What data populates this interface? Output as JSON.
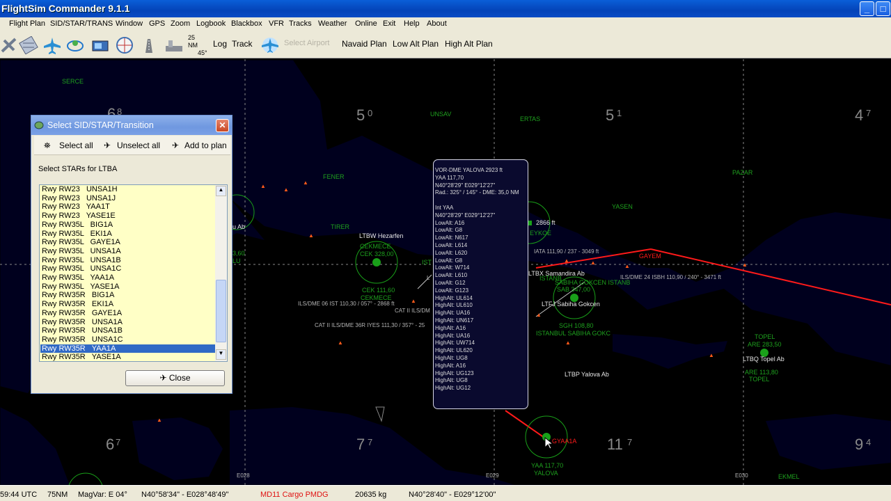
{
  "window": {
    "title": "FlightSim Commander 9.1.1"
  },
  "menu": [
    "Flight Plan",
    "SID/STAR/TRANS",
    "Window",
    "GPS",
    "Zoom",
    "Logbook",
    "Blackbox",
    "VFR",
    "Tracks",
    "Weather",
    "Online",
    "Exit",
    "Help",
    "About"
  ],
  "toolbar": {
    "zoom_top": "25",
    "zoom_mid": "NM",
    "zoom_bot": "45°",
    "log": "Log",
    "track": "Track",
    "select_airport": "Select Airport",
    "navaid_plan": "Navaid Plan",
    "low_alt_plan": "Low Alt Plan",
    "high_alt_plan": "High Alt Plan"
  },
  "map": {
    "grid_numbers": [
      {
        "big": "6",
        "small": "8"
      },
      {
        "big": "5",
        "small": "0"
      },
      {
        "big": "5",
        "small": "1"
      },
      {
        "big": "4",
        "small": "7"
      },
      {
        "big": "6",
        "small": "7"
      },
      {
        "big": "7",
        "small": "7"
      },
      {
        "big": "11",
        "small": "7"
      },
      {
        "big": "9",
        "small": "4"
      }
    ],
    "waypoints": [
      "SERCE",
      "UNSAV",
      "ERTAS",
      "FENER",
      "PAZAR",
      "YASEN",
      "TIRER",
      "GAYEM",
      "TOPEL",
      "EKMEL"
    ],
    "labels": [
      "LTBW Hezarfen",
      "LTFJ Sabiha Gokcen",
      "LTBX Samandira Ab",
      "LTBQ Topel Ab",
      "LTBP Yalova Ab",
      "SABIHA GOKCEN ISTANB",
      "SAB 347,00",
      "ISTANBUL SABIHA GOKC",
      "SGH 108,80",
      "CEKMECE",
      "CEK 328,00",
      "CEK 111,60",
      "CEKMECE",
      "ILS/DME 06  IST 110,30 / 057° - 2868 ft",
      "CAT II ILS/DME 36R  IYES 111,30 / 357° - 25",
      "CAT II ILS/DM",
      "IATA 111,90 / 237 - 3049 ft",
      "ILS/DME 24  ISBH 110,90 / 240° - 3471 ft",
      "ARE 283,50",
      "ARE 113,80",
      "TOPEL",
      "YAA 117,70",
      "YALOVA",
      "2866 ft",
      "EYKOE",
      "E028",
      "E029",
      "E030",
      "u Ab",
      "3,60",
      "LU",
      "IST",
      "L",
      "ISTANB",
      "GYAA1A"
    ],
    "route_color": "#ff1a1a"
  },
  "popup": {
    "lines": [
      "VOR-DME YALOVA 2923 ft",
      "YAA 117,70",
      "N40°28'29\"  E029°12'27\"",
      "Rad.: 325° / 145° - DME: 35,0 NM",
      "",
      "Int YAA",
      "N40°28'29\"  E029°12'27\"",
      "LowAlt: A16",
      "LowAlt: G8",
      "LowAlt: N617",
      "LowAlt: L614",
      "LowAlt: L620",
      "LowAlt: G8",
      "LowAlt: W714",
      "LowAlt: L610",
      "LowAlt: G12",
      "LowAlt: G123",
      "HighAlt: UL614",
      "HighAlt: UL610",
      "HighAlt: UA16",
      "HighAlt: UN617",
      "HighAlt: A16",
      "HighAlt: UA16",
      "HighAlt: UW714",
      "HighAlt: UL620",
      "HighAlt: UG8",
      "HighAlt: A16",
      "HighAlt: UG123",
      "HighAlt: UG8",
      "HighAlt: UG12"
    ]
  },
  "dialog": {
    "title": "Select SID/STAR/Transition",
    "select_all": "Select all",
    "unselect_all": "Unselect all",
    "add_to_plan": "Add to plan",
    "label": "Select STARs for LTBA",
    "items": [
      "Rwy RW23   UNSA1H",
      "Rwy RW23   UNSA1J",
      "Rwy RW23   YAA1T",
      "Rwy RW23   YASE1E",
      "Rwy RW35L   BIG1A",
      "Rwy RW35L   EKI1A",
      "Rwy RW35L   GAYE1A",
      "Rwy RW35L   UNSA1A",
      "Rwy RW35L   UNSA1B",
      "Rwy RW35L   UNSA1C",
      "Rwy RW35L   YAA1A",
      "Rwy RW35L   YASE1A",
      "Rwy RW35R   BIG1A",
      "Rwy RW35R   EKI1A",
      "Rwy RW35R   GAYE1A",
      "Rwy RW35R   UNSA1A",
      "Rwy RW35R   UNSA1B",
      "Rwy RW35R   UNSA1C",
      "Rwy RW35R   YAA1A",
      "Rwy RW35R   YASE1A"
    ],
    "selected_index": 18,
    "close": "Close"
  },
  "status": {
    "time": "59:44 UTC",
    "range": "75NM",
    "magvar": "MagVar: E 04°",
    "pos1": "N40°58'34\" - E028°48'49\"",
    "aircraft": "MD11 Cargo PMDG",
    "weight": "20635 kg",
    "pos2": "N40°28'40\" - E029°12'00\""
  }
}
